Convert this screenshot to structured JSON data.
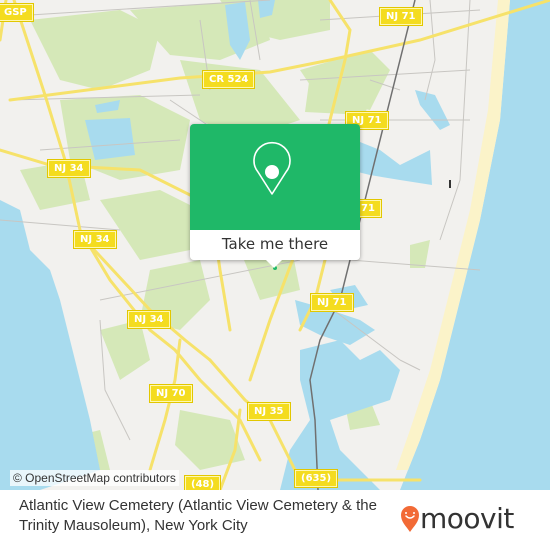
{
  "map": {
    "attribution": "© OpenStreetMap contributors",
    "colors": {
      "land": "#f2f1ee",
      "park": "#d5e8b8",
      "water": "#a8dbee",
      "beach": "#fbf3c9",
      "road": "#f6e26a",
      "rail": "#707070",
      "minor_road": "#c8c6c2"
    },
    "route_shields": [
      {
        "id": "gsp",
        "label": "GSP"
      },
      {
        "id": "nj71-top",
        "label": "NJ 71"
      },
      {
        "id": "cr524",
        "label": "CR 524"
      },
      {
        "id": "nj71-mid",
        "label": "NJ 71"
      },
      {
        "id": "nj34-a",
        "label": "NJ 34"
      },
      {
        "id": "nj71-right",
        "label": "71"
      },
      {
        "id": "nj34-b",
        "label": "NJ 34"
      },
      {
        "id": "nj71-low",
        "label": "NJ 71"
      },
      {
        "id": "nj34-c",
        "label": "NJ 34"
      },
      {
        "id": "nj70",
        "label": "NJ 70"
      },
      {
        "id": "nj35",
        "label": "NJ 35"
      },
      {
        "id": "cr635",
        "label": "(635)"
      },
      {
        "id": "cr48",
        "label": "(48)"
      }
    ]
  },
  "popup": {
    "icon": "map-pin-icon",
    "button_label": "Take me there",
    "color": "#1fb868"
  },
  "footer": {
    "title": "Atlantic View Cemetery (Atlantic View Cemetery & the Trinity Mausoleum), New York City",
    "brand": {
      "name": "moovit",
      "logo_icon": "moovit-pin-icon",
      "logo_color": "#f26a36"
    }
  }
}
